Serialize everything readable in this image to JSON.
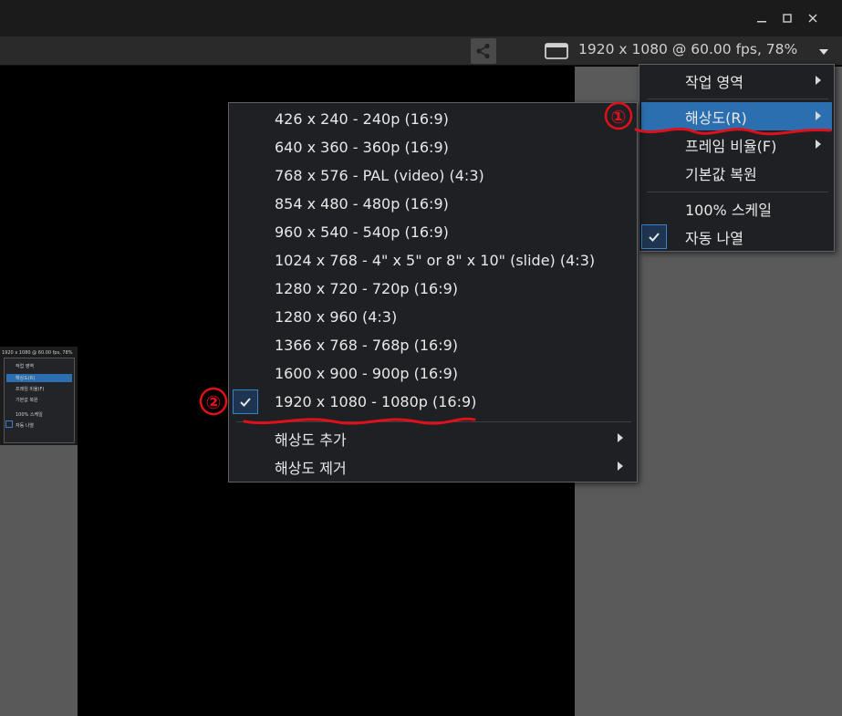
{
  "window": {
    "minimize_icon": "minimize-icon",
    "maximize_icon": "maximize-icon",
    "close_icon": "close-icon"
  },
  "toolbar": {
    "share_icon": "share-icon",
    "monitor_icon": "monitor-icon",
    "status": "1920 x 1080 @ 60.00 fps, 78%",
    "dropdown_icon": "caret-down-icon"
  },
  "main_menu": {
    "items": [
      {
        "label": "작업 영역",
        "has_submenu": true
      },
      {
        "label": "해상도(R)",
        "has_submenu": true,
        "highlighted": true
      },
      {
        "label": "프레임 비율(F)",
        "has_submenu": true
      },
      {
        "label": "기본값 복원",
        "has_submenu": false
      },
      {
        "label": "100% 스케일",
        "has_submenu": false
      },
      {
        "label": "자동 나열",
        "has_submenu": false,
        "checked": true
      }
    ]
  },
  "resolution_menu": {
    "items": [
      {
        "label": "426 x 240 - 240p (16:9)"
      },
      {
        "label": "640 x 360 - 360p (16:9)"
      },
      {
        "label": "768 x 576 - PAL (video) (4:3)"
      },
      {
        "label": "854 x 480 - 480p (16:9)"
      },
      {
        "label": "960 x 540 - 540p (16:9)"
      },
      {
        "label": "1024 x 768 - 4\" x 5\" or 8\" x 10\" (slide) (4:3)"
      },
      {
        "label": "1280 x 720 - 720p (16:9)"
      },
      {
        "label": "1280 x 960 (4:3)"
      },
      {
        "label": "1366 x 768 - 768p (16:9)"
      },
      {
        "label": "1600 x 900 - 900p (16:9)"
      },
      {
        "label": "1920 x 1080 - 1080p (16:9)",
        "checked": true
      }
    ],
    "add": "해상도 추가",
    "remove": "해상도 제거"
  },
  "annotations": {
    "step1": "①",
    "step2": "②",
    "color": "#e0101a"
  },
  "thumbnail": {
    "status": "1920 x 1080 @ 60.00 fps, 78%",
    "items": [
      "작업 영역",
      "해상도(R)",
      "프레임 비율(F)",
      "기본값 복원",
      "100% 스케일",
      "자동 나열"
    ]
  },
  "colors": {
    "highlight": "#2c6fb0",
    "menu_bg": "#1f2024",
    "canvas_gray": "#5a5a5a"
  }
}
